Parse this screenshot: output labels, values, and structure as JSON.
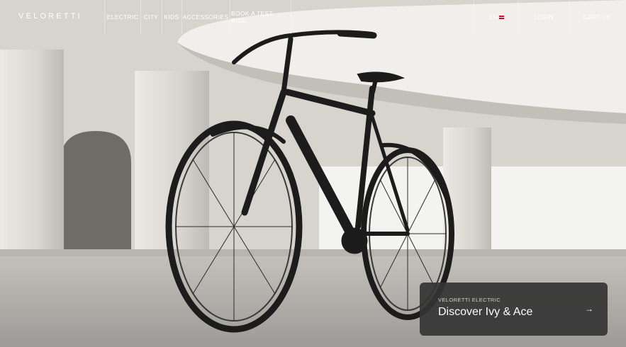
{
  "brand": {
    "logo": "VELORETTI"
  },
  "nav": {
    "items": [
      {
        "label": "ELECTRIC"
      },
      {
        "label": "CITY"
      },
      {
        "label": "KIDS"
      },
      {
        "label": "ACCESSORIES"
      },
      {
        "label": "BOOK A TEST RIDE"
      }
    ],
    "language": "EN",
    "login": "LOGIN",
    "cart": "CART (0)"
  },
  "hero": {
    "image": "black electric city bicycle in white concrete hall",
    "cta": {
      "kicker": "VELORETTI ELECTRIC",
      "title": "Discover Ivy & Ace",
      "icon": "arrow-right-icon"
    }
  },
  "colors": {
    "nav_text": "#ffffff",
    "cta_bg": "#343434",
    "bike": "#1c1c1c"
  }
}
